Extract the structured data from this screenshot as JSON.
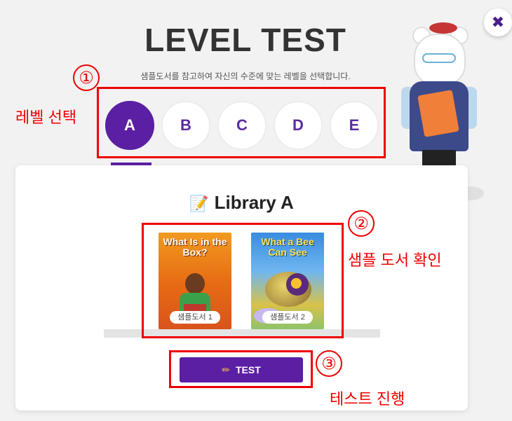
{
  "header": {
    "title": "LEVEL TEST",
    "subtitle": "샘플도서를 참고하여 자신의 수준에 맞는 레벨을 선택합니다.",
    "close_glyph": "✖"
  },
  "levels": {
    "items": [
      "A",
      "B",
      "C",
      "D",
      "E"
    ],
    "selected": "A"
  },
  "library": {
    "title": "Library A",
    "books": [
      {
        "cover_title": "What Is in the Box?",
        "label": "샘플도서 1"
      },
      {
        "cover_title": "What a Bee Can See",
        "label": "샘플도서 2"
      }
    ]
  },
  "test_button": {
    "label": "TEST"
  },
  "annotations": {
    "num1": "①",
    "num2": "②",
    "num3": "③",
    "label1": "레벨 선택",
    "label2": "샘플 도서 확인",
    "label3": "테스트 진행"
  },
  "colors": {
    "accent": "#5b1fa3",
    "annotation": "#e00000"
  }
}
